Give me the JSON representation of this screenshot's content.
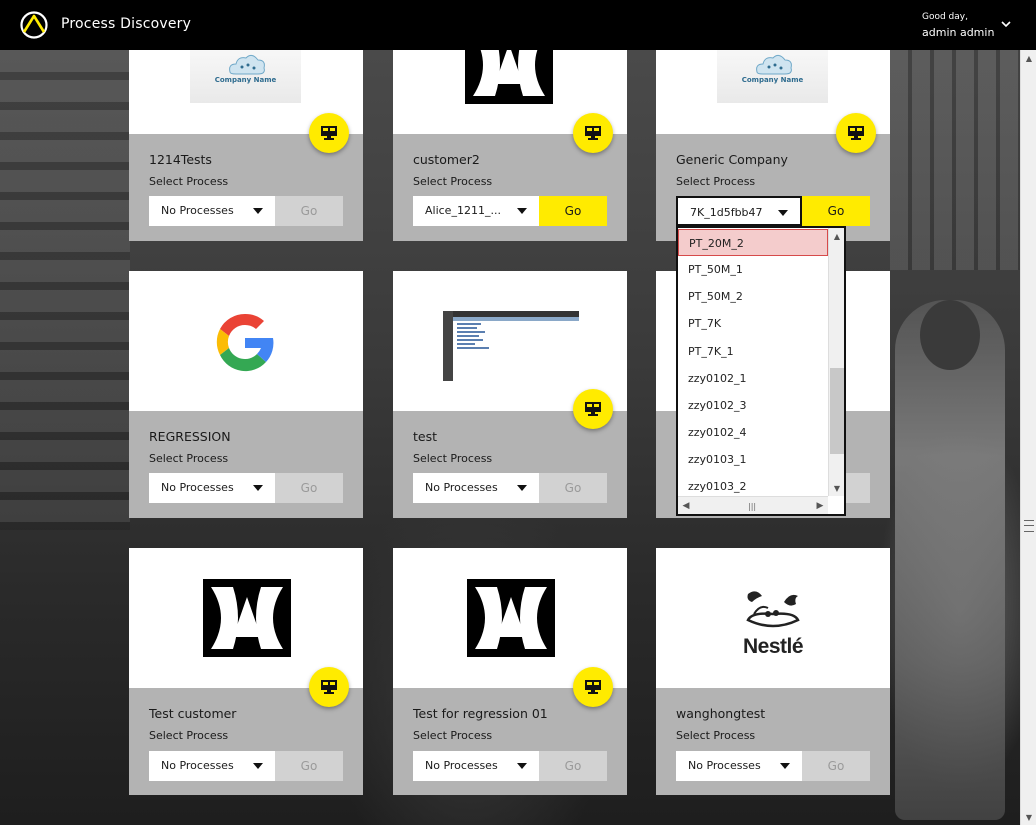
{
  "header": {
    "app_title": "Process Discovery",
    "greeting": "Good day,",
    "user_name": "admin admin"
  },
  "common": {
    "select_label": "Select Process",
    "go_label": "Go"
  },
  "cards": [
    {
      "name": "1214Tests",
      "select_value": "No Processes",
      "go_state": "disabled",
      "logo": "company-name-cloud",
      "logo_text": "Company Name"
    },
    {
      "name": "customer2",
      "select_value": "Alice_1211_...",
      "go_state": "active",
      "logo": "dxc"
    },
    {
      "name": "Generic Company",
      "select_value": "7K_1d5fbb47",
      "go_state": "active",
      "logo": "company-name-cloud",
      "logo_text": "Company Name"
    },
    {
      "name": "REGRESSION",
      "select_value": "No Processes",
      "go_state": "disabled",
      "logo": "google-g"
    },
    {
      "name": "test",
      "select_value": "No Processes",
      "go_state": "disabled",
      "logo": "screenshot-thumbnail"
    },
    {
      "name": "",
      "select_value": "",
      "go_state": "disabled",
      "logo": ""
    },
    {
      "name": "Test customer",
      "select_value": "No Processes",
      "go_state": "disabled",
      "logo": "dxc"
    },
    {
      "name": "Test for regression 01",
      "select_value": "No Processes",
      "go_state": "disabled",
      "logo": "dxc"
    },
    {
      "name": "wanghongtest",
      "select_value": "No Processes",
      "go_state": "disabled",
      "logo": "nestle",
      "logo_text": "Nestlé"
    }
  ],
  "dropdown": {
    "items": [
      "PT_20M_2",
      "PT_50M_1",
      "PT_50M_2",
      "PT_7K",
      "PT_7K_1",
      "zzy0102_1",
      "zzy0102_3",
      "zzy0102_4",
      "zzy0103_1",
      "zzy0103_2"
    ],
    "highlighted": "PT_20M_2"
  },
  "colors": {
    "accent": "#ffeb00",
    "card_bg": "#b3b3b3",
    "header_bg": "#000000",
    "highlight_bg": "#f4cccc"
  },
  "icons": {
    "app_logo": "triangle-circle-logo-icon",
    "card_action": "monitor-icon",
    "user_menu": "chevron-down-icon"
  }
}
